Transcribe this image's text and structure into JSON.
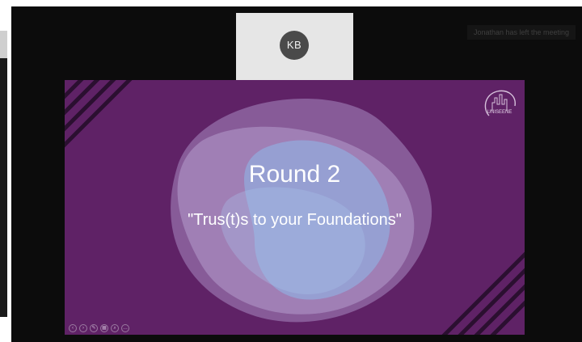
{
  "participant": {
    "initials": "KB"
  },
  "notification": {
    "text": "Jonathan has left the meeting"
  },
  "slide": {
    "title": "Round 2",
    "subtitle": "\"Trus(t)s to  your Foundations\"",
    "logo_text": "UNISEENE",
    "background_color": "#5f2266"
  },
  "slide_controls": [
    {
      "icon": "previous-icon"
    },
    {
      "icon": "next-icon"
    },
    {
      "icon": "pen-icon"
    },
    {
      "icon": "slides-grid-icon"
    },
    {
      "icon": "zoom-icon"
    },
    {
      "icon": "more-icon"
    }
  ]
}
